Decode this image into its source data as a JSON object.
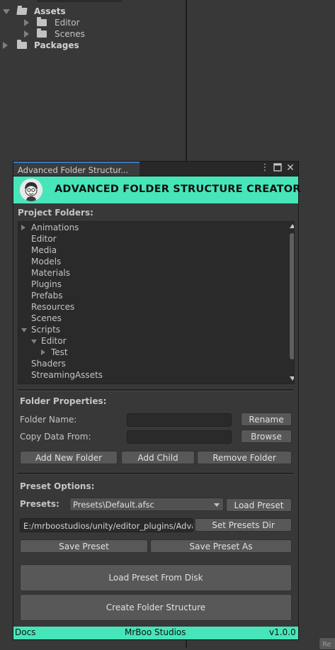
{
  "project_tree": {
    "assets_label": "Assets",
    "editor_label": "Editor",
    "scenes_label": "Scenes",
    "packages_label": "Packages"
  },
  "window": {
    "tab_title": "Advanced Folder Structur...",
    "header_title": "ADVANCED FOLDER STRUCTURE CREATOR"
  },
  "project_folders": {
    "heading": "Project Folders:",
    "items": [
      {
        "label": "Animations",
        "collapsed": true
      },
      {
        "label": "Editor"
      },
      {
        "label": "Media"
      },
      {
        "label": "Models"
      },
      {
        "label": "Materials"
      },
      {
        "label": "Plugins"
      },
      {
        "label": "Prefabs"
      },
      {
        "label": "Resources"
      },
      {
        "label": "Scenes"
      },
      {
        "label": "Scripts",
        "expanded": true
      },
      {
        "label": "Editor",
        "expanded": true
      },
      {
        "label": "Test",
        "collapsed": true
      },
      {
        "label": "Shaders"
      },
      {
        "label": "StreamingAssets"
      }
    ]
  },
  "folder_properties": {
    "heading": "Folder Properties:",
    "folder_name_label": "Folder Name:",
    "folder_name_value": "",
    "copy_data_label": "Copy Data From:",
    "copy_data_value": "",
    "rename_button": "Rename",
    "browse_button": "Browse",
    "add_new_folder_button": "Add New Folder",
    "add_child_button": "Add Child",
    "remove_folder_button": "Remove Folder"
  },
  "preset_options": {
    "heading": "Preset Options:",
    "presets_label": "Presets:",
    "selected_preset": "Presets\\Default.afsc",
    "load_preset_button": "Load Preset",
    "presets_dir_value": "E:/mrboostudios/unity/editor_plugins/Advan",
    "set_presets_dir_button": "Set Presets Dir",
    "save_preset_button": "Save Preset",
    "save_preset_as_button": "Save Preset As"
  },
  "actions": {
    "load_from_disk_button": "Load Preset From Disk",
    "create_structure_button": "Create Folder Structure"
  },
  "footer": {
    "docs_link": "Docs",
    "studio_name": "MrBoo Studios",
    "version": "v1.0.0"
  },
  "corner_button": "Re",
  "colors": {
    "accent": "#47e6ba",
    "panel": "#383838",
    "button": "#585858",
    "field": "#2a2a2a"
  }
}
